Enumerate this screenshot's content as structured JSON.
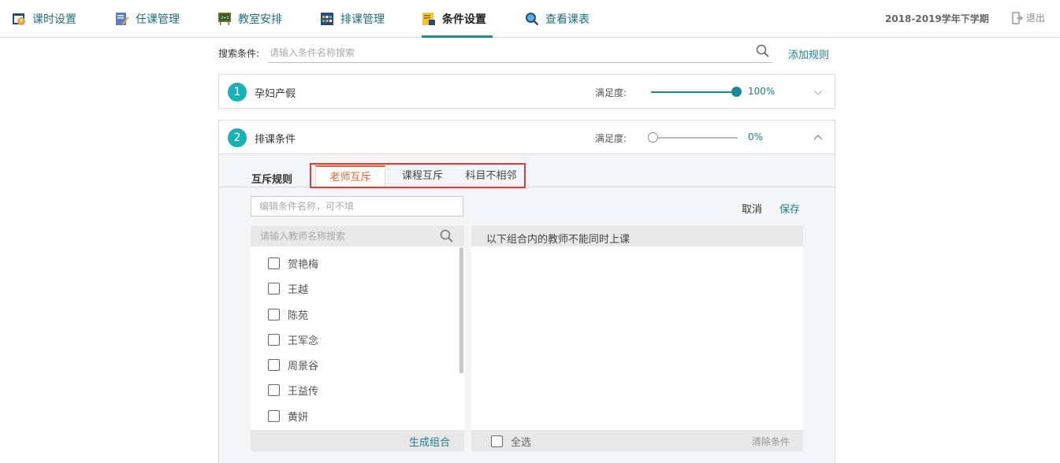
{
  "nav": {
    "items": [
      {
        "label": "课时设置",
        "icon": "clock-calendar-icon"
      },
      {
        "label": "任课管理",
        "icon": "pencil-doc-icon"
      },
      {
        "label": "教室安排",
        "icon": "blackboard-icon"
      },
      {
        "label": "排课管理",
        "icon": "schedule-grid-icon"
      },
      {
        "label": "条件设置",
        "icon": "condition-doc-icon"
      },
      {
        "label": "查看课表",
        "icon": "magnifier-icon"
      }
    ],
    "active_index": 4,
    "term": "2018-2019学年下学期",
    "logout": "退出"
  },
  "search": {
    "label": "搜索条件:",
    "placeholder": "请输入条件名称搜索",
    "add_rule": "添加规则"
  },
  "rules": [
    {
      "number": "1",
      "title": "孕妇产假",
      "satisfaction_label": "满足度:",
      "satisfaction": 100,
      "satisfaction_text": "100%",
      "expanded": false
    },
    {
      "number": "2",
      "title": "排课条件",
      "satisfaction_label": "满足度:",
      "satisfaction": 0,
      "satisfaction_text": "0%",
      "expanded": true
    }
  ],
  "editor": {
    "section_heading": "互斥规则",
    "tabs": [
      "老师互斥",
      "课程互斥",
      "科目不相邻"
    ],
    "active_tab": 0,
    "name_placeholder": "编辑条件名称，可不填",
    "cancel": "取消",
    "save": "保存",
    "teacher_search_placeholder": "请输入教师名称搜索",
    "teachers": [
      "贺艳梅",
      "王越",
      "陈苑",
      "王军念",
      "周景谷",
      "王益传",
      "黄妍"
    ],
    "generate": "生成组合",
    "right_header": "以下组合内的教师不能同时上课",
    "select_all": "全选",
    "clear": "清除条件"
  },
  "colors": {
    "accent": "#1a8a94",
    "active_tab": "#e56238",
    "highlight_box": "#e03c3c",
    "badge": "#1ab0b5"
  }
}
